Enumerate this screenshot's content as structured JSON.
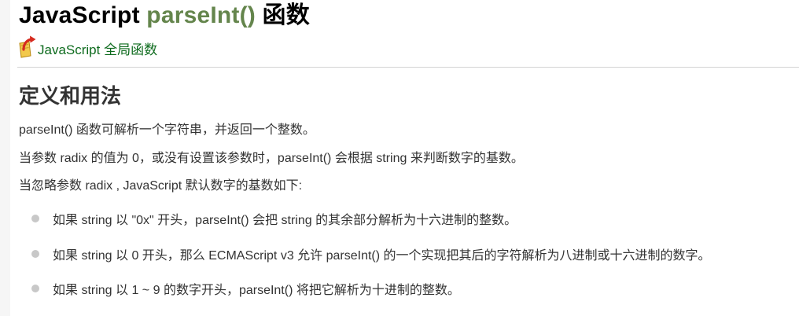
{
  "page": {
    "title_prefix": "JavaScript ",
    "title_accent": "parseInt()",
    "title_suffix": " 函数",
    "back_link_label": "JavaScript 全局函数",
    "back_link_icon": "back-arrow-icon"
  },
  "section": {
    "heading": "定义和用法",
    "paragraphs": [
      "parseInt() 函数可解析一个字符串，并返回一个整数。",
      "当参数 radix 的值为 0，或没有设置该参数时，parseInt() 会根据 string 来判断数字的基数。",
      "当忽略参数 radix , JavaScript 默认数字的基数如下:"
    ],
    "bullets": [
      "如果 string 以 \"0x\" 开头，parseInt() 会把 string 的其余部分解析为十六进制的整数。",
      "如果 string 以 0 开头，那么 ECMAScript v3 允许 parseInt() 的一个实现把其后的字符解析为八进制或十六进制的数字。",
      "如果 string 以 1 ~ 9 的数字开头，parseInt() 将把它解析为十进制的整数。"
    ]
  },
  "colors": {
    "title_accent": "#64854c",
    "link": "#0e6b1e",
    "text": "#333333",
    "bullet": "#c8c8c8"
  }
}
